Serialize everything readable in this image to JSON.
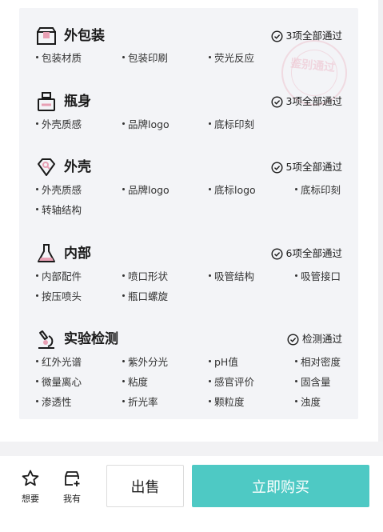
{
  "stamp": {
    "text": "鉴别通过"
  },
  "sections": [
    {
      "title": "外包装",
      "status": "3项全部通过",
      "items": [
        "包装材质",
        "包装印刷",
        "荧光反应"
      ]
    },
    {
      "title": "瓶身",
      "status": "3项全部通过",
      "items": [
        "外壳质感",
        "品牌logo",
        "底标印刻"
      ]
    },
    {
      "title": "外壳",
      "status": "5项全部通过",
      "items": [
        "外壳质感",
        "品牌logo",
        "底标logo",
        "底标印刻",
        "转轴结构"
      ]
    },
    {
      "title": "内部",
      "status": "6项全部通过",
      "items": [
        "内部配件",
        "喷口形状",
        "吸管结构",
        "吸管接口",
        "按压喷头",
        "瓶口螺旋"
      ]
    },
    {
      "title": "实验检测",
      "status": "检测通过",
      "items": [
        "红外光谱",
        "紫外分光",
        "pH值",
        "相对密度",
        "微量离心",
        "粘度",
        "感官评价",
        "固含量",
        "渗透性",
        "折光率",
        "颗粒度",
        "浊度"
      ]
    }
  ],
  "bottom_bar": {
    "want_label": "想要",
    "mine_label": "我有",
    "sell_label": "出售",
    "buy_label": "立即购买"
  },
  "colors": {
    "accent": "#4ec9c4",
    "card_bg": "#f3f4f7",
    "icon_pink": "#e8a0b4"
  }
}
